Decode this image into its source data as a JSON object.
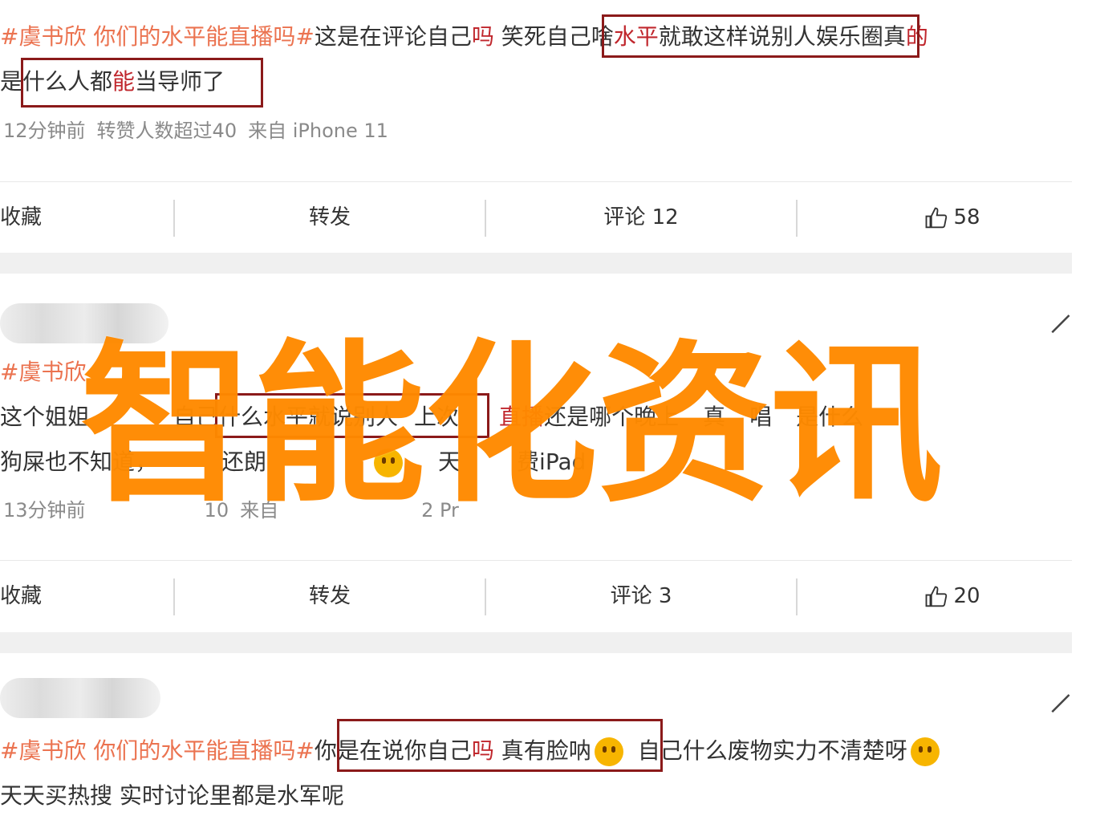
{
  "post1": {
    "line1_tag": "#虞书欣 你们的水平能直播吗#",
    "line1_a": "这是在评论自己",
    "line1_b": "吗",
    "line1_c": " 笑死",
    "line1_boxed_a": "自己啥",
    "line1_boxed_b": "水平",
    "line1_boxed_c": "就敢这样说别人",
    "line1_d": "娱乐圈真",
    "line1_e": "的",
    "line2_a": "是",
    "line2_boxed_a": "什么人都",
    "line2_boxed_b": "能",
    "line2_boxed_c": "当导师了",
    "meta_time": "12分钟前",
    "meta_reposts": "转赞人数超过40",
    "meta_source": "来自 iPhone 11"
  },
  "actions1": {
    "collect": "收藏",
    "repost": "转发",
    "comment": "评论 12",
    "like": "58"
  },
  "post2": {
    "line1_tag": "#虞书欣",
    "line2_a": "这个姐姐",
    "line2_boxed": "自己什么水平就说别人",
    "line2_b": "上次",
    "line2_c": "直播",
    "line2_d": "还是哪个晚上",
    "line2_e": "真",
    "line2_f": "唱",
    "line2_g": "是什么",
    "line3_a": "狗屎也不知道，",
    "line3_b": "还朗",
    "line3_c": "天",
    "line3_d": "费iPad",
    "meta_time": "13分钟前",
    "meta_reposts": "10",
    "meta_source": "来自",
    "meta_device": "2 Pr"
  },
  "actions2": {
    "collect": "收藏",
    "repost": "转发",
    "comment": "评论 3",
    "like": "20"
  },
  "post3": {
    "line1_tag": "#虞书欣 你们的水平能直播吗#",
    "line1_boxed_a": "你是在说你自己",
    "line1_boxed_b": "吗",
    "line1_boxed_c": " 真有脸呐",
    "line1_after": "自己什么废物实力不清楚呀",
    "line2": "天天买热搜 实时讨论里都是水军呢"
  },
  "watermark": "智能化资讯",
  "colors": {
    "tag": "#eb7350",
    "keyword": "#c0272d",
    "box": "#8b1a1a",
    "watermark": "#ff8a00",
    "meta": "#8a8a8a"
  }
}
